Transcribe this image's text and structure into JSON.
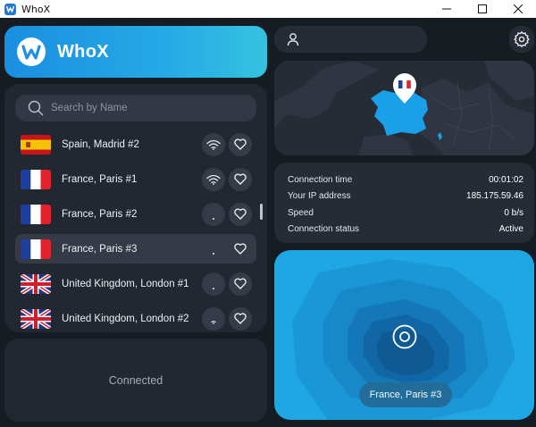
{
  "window": {
    "title": "WhoX"
  },
  "brand": {
    "name": "WhoX"
  },
  "search": {
    "placeholder": "Search by Name"
  },
  "servers": [
    {
      "name": "Spain, Madrid #2",
      "flag": "es",
      "signal": "full",
      "selected": false
    },
    {
      "name": "France, Paris #1",
      "flag": "fr",
      "signal": "full",
      "selected": false
    },
    {
      "name": "France, Paris #2",
      "flag": "fr",
      "signal": "dot",
      "selected": false
    },
    {
      "name": "France, Paris #3",
      "flag": "fr",
      "signal": "dot",
      "selected": true
    },
    {
      "name": "United Kingdom, London #1",
      "flag": "gb",
      "signal": "dot",
      "selected": false
    },
    {
      "name": "United Kingdom, London #2",
      "flag": "gb",
      "signal": "low",
      "selected": false
    }
  ],
  "status": {
    "text": "Connected"
  },
  "connection": {
    "time_label": "Connection time",
    "time_value": "00:01:02",
    "ip_label": "Your IP address",
    "ip_value": "185.175.59.46",
    "speed_label": "Speed",
    "speed_value": "0 b/s",
    "status_label": "Connection status",
    "status_value": "Active"
  },
  "current_location": {
    "name": "France, Paris #3"
  },
  "colors": {
    "accent": "#1ea7e4",
    "panel": "#222832",
    "background": "#171b22"
  },
  "icons": [
    "app-logo-icon",
    "user-icon",
    "gear-icon",
    "search-icon",
    "wifi-icon",
    "heart-icon",
    "location-pin-icon",
    "target-icon"
  ]
}
